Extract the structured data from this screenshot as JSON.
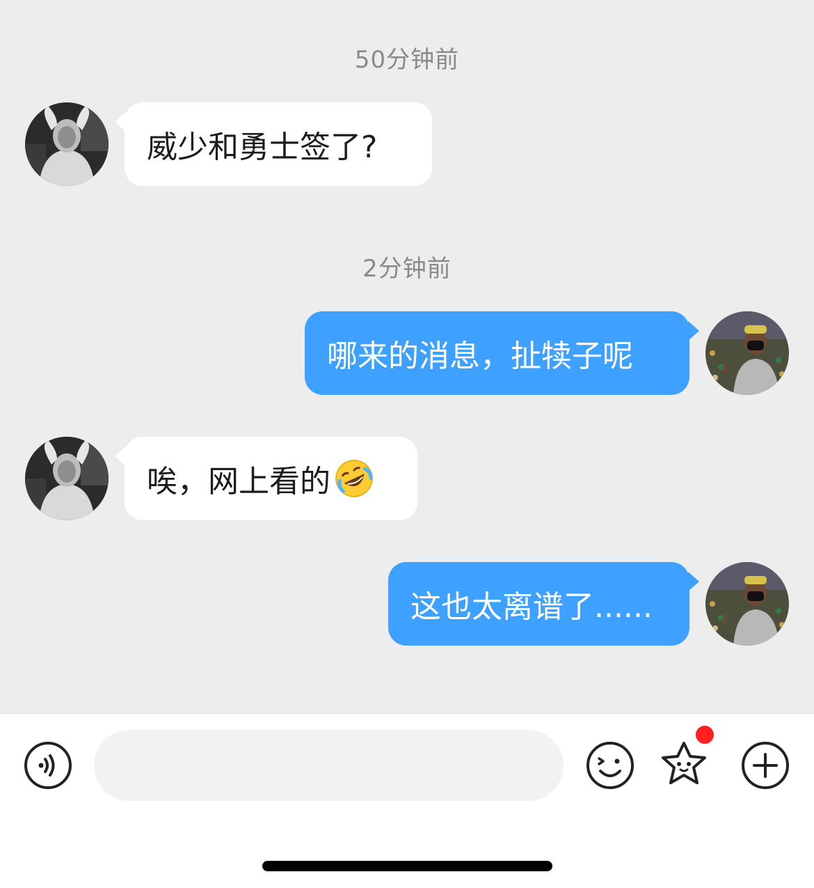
{
  "conversation": {
    "timestamps": [
      "50分钟前",
      "2分钟前"
    ],
    "messages": [
      {
        "sender": "other",
        "text": "威少和勇士签了?"
      },
      {
        "sender": "me",
        "text": "哪来的消息，扯犊子呢"
      },
      {
        "sender": "other",
        "text": "唉，网上看的",
        "emoji": "rolling-on-floor-laughing-emoji"
      },
      {
        "sender": "me",
        "text": "这也太离谱了......"
      }
    ]
  },
  "toolbar": {
    "voice_icon": "voice-message-icon",
    "input_value": "",
    "emoji_icon": "smiley-face-icon",
    "sticker_icon": "star-sticker-icon",
    "plus_icon": "plus-circle-icon",
    "notification_color": "#ff2020"
  },
  "colors": {
    "chat_background": "#ededed",
    "my_bubble": "#3ea0ff",
    "their_bubble": "#ffffff"
  }
}
